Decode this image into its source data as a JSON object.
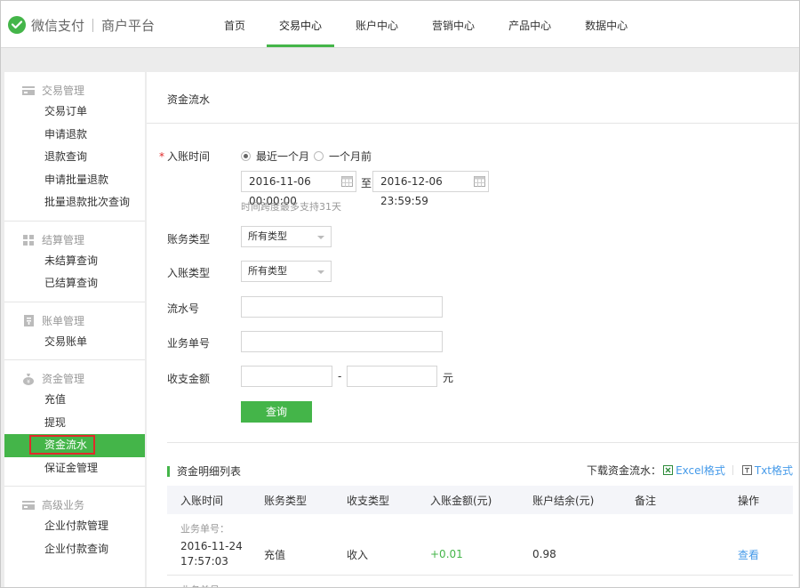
{
  "header": {
    "brand": "微信支付",
    "brand_sub": "商户平台",
    "nav": [
      {
        "label": "首页"
      },
      {
        "label": "交易中心"
      },
      {
        "label": "账户中心"
      },
      {
        "label": "营销中心"
      },
      {
        "label": "产品中心"
      },
      {
        "label": "数据中心"
      }
    ],
    "active_nav": "交易中心"
  },
  "sidebar": {
    "sections": [
      {
        "title": "交易管理",
        "icon": "card-icon",
        "items": [
          "交易订单",
          "申请退款",
          "退款查询",
          "申请批量退款",
          "批量退款批次查询"
        ]
      },
      {
        "title": "结算管理",
        "icon": "grid-icon",
        "items": [
          "未结算查询",
          "已结算查询"
        ]
      },
      {
        "title": "账单管理",
        "icon": "bill-icon",
        "items": [
          "交易账单"
        ]
      },
      {
        "title": "资金管理",
        "icon": "money-bag-icon",
        "items": [
          "充值",
          "提现",
          "资金流水",
          "保证金管理"
        ]
      },
      {
        "title": "高级业务",
        "icon": "card-icon",
        "items": [
          "企业付款管理",
          "企业付款查询"
        ]
      }
    ],
    "active_item": "资金流水"
  },
  "main": {
    "title": "资金流水",
    "form": {
      "time_label": "入账时间",
      "required_mark": "*",
      "radio_recent": "最近一个月",
      "radio_before": "一个月前",
      "date_from": "2016-11-06 00:00:00",
      "date_to_sep": "至",
      "date_to": "2016-12-06 23:59:59",
      "time_hint": "时间跨度最多支持31天",
      "account_type_label": "账务类型",
      "account_type_value": "所有类型",
      "entry_type_label": "入账类型",
      "entry_type_value": "所有类型",
      "serial_label": "流水号",
      "serial_value": "",
      "order_label": "业务单号",
      "order_value": "",
      "amount_label": "收支金额",
      "amount_sep": "-",
      "amount_unit": "元",
      "amount_min": "",
      "amount_max": "",
      "query_button": "查询"
    },
    "list": {
      "title": "资金明细列表",
      "download_label": "下载资金流水：",
      "excel": "Excel格式",
      "txt": "Txt格式",
      "columns": [
        "入账时间",
        "账务类型",
        "收支类型",
        "入账金额(元)",
        "账户结余(元)",
        "备注",
        "操作"
      ],
      "order_no_label": "业务单号：",
      "rows": [
        {
          "date": "2016-11-24",
          "time": "17:57:03",
          "account_type": "充值",
          "io_type": "收入",
          "amount": "+0.01",
          "balance": "0.98",
          "remark": "",
          "action": "查看"
        }
      ]
    }
  },
  "colors": {
    "accent": "#44b549",
    "link": "#459ae9",
    "highlight": "#e02a2a"
  }
}
